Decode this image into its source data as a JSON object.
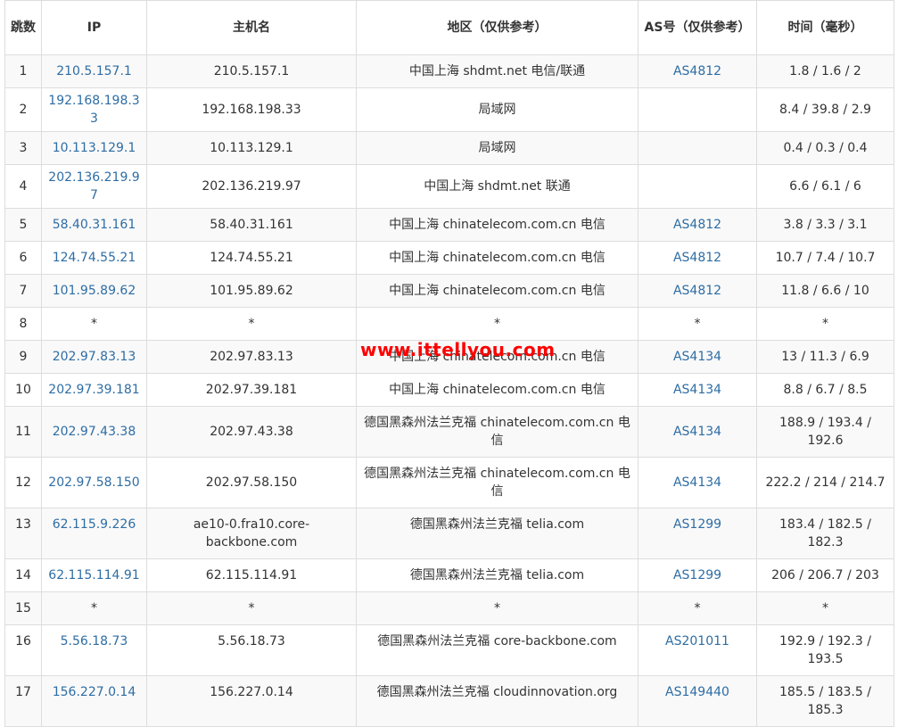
{
  "headers": {
    "hop": "跳数",
    "ip": "IP",
    "host": "主机名",
    "region": "地区（仅供参考）",
    "as": "AS号（仅供参考）",
    "time": "时间（毫秒）"
  },
  "rows": [
    {
      "hop": "1",
      "ip": "210.5.157.1",
      "host": "210.5.157.1",
      "region": "中国上海 shdmt.net 电信/联通",
      "as": "AS4812",
      "time": "1.8 / 1.6 / 2"
    },
    {
      "hop": "2",
      "ip": "192.168.198.33",
      "host": "192.168.198.33",
      "region": "局域网",
      "as": "",
      "time": "8.4 / 39.8 / 2.9"
    },
    {
      "hop": "3",
      "ip": "10.113.129.1",
      "host": "10.113.129.1",
      "region": "局域网",
      "as": "",
      "time": "0.4 / 0.3 / 0.4"
    },
    {
      "hop": "4",
      "ip": "202.136.219.97",
      "host": "202.136.219.97",
      "region": "中国上海 shdmt.net 联通",
      "as": "",
      "time": "6.6 / 6.1 / 6"
    },
    {
      "hop": "5",
      "ip": "58.40.31.161",
      "host": "58.40.31.161",
      "region": "中国上海 chinatelecom.com.cn 电信",
      "as": "AS4812",
      "time": "3.8 / 3.3 / 3.1"
    },
    {
      "hop": "6",
      "ip": "124.74.55.21",
      "host": "124.74.55.21",
      "region": "中国上海 chinatelecom.com.cn 电信",
      "as": "AS4812",
      "time": "10.7 / 7.4 / 10.7"
    },
    {
      "hop": "7",
      "ip": "101.95.89.62",
      "host": "101.95.89.62",
      "region": "中国上海 chinatelecom.com.cn 电信",
      "as": "AS4812",
      "time": "11.8 / 6.6 / 10"
    },
    {
      "hop": "8",
      "ip": "*",
      "host": "*",
      "region": "*",
      "as": "*",
      "time": "*"
    },
    {
      "hop": "9",
      "ip": "202.97.83.13",
      "host": "202.97.83.13",
      "region": "中国上海 chinatelecom.com.cn 电信",
      "as": "AS4134",
      "time": "13 / 11.3 / 6.9"
    },
    {
      "hop": "10",
      "ip": "202.97.39.181",
      "host": "202.97.39.181",
      "region": "中国上海 chinatelecom.com.cn 电信",
      "as": "AS4134",
      "time": "8.8 / 6.7 / 8.5"
    },
    {
      "hop": "11",
      "ip": "202.97.43.38",
      "host": "202.97.43.38",
      "region": "德国黑森州法兰克福 chinatelecom.com.cn 电信",
      "as": "AS4134",
      "time": "188.9 / 193.4 / 192.6"
    },
    {
      "hop": "12",
      "ip": "202.97.58.150",
      "host": "202.97.58.150",
      "region": "德国黑森州法兰克福 chinatelecom.com.cn 电信",
      "as": "AS4134",
      "time": "222.2 / 214 / 214.7"
    },
    {
      "hop": "13",
      "ip": "62.115.9.226",
      "host": "ae10-0.fra10.core-backbone.com",
      "region": "德国黑森州法兰克福 telia.com",
      "as": "AS1299",
      "time": "183.4 / 182.5 / 182.3"
    },
    {
      "hop": "14",
      "ip": "62.115.114.91",
      "host": "62.115.114.91",
      "region": "德国黑森州法兰克福 telia.com",
      "as": "AS1299",
      "time": "206 / 206.7 / 203"
    },
    {
      "hop": "15",
      "ip": "*",
      "host": "*",
      "region": "*",
      "as": "*",
      "time": "*"
    },
    {
      "hop": "16",
      "ip": "5.56.18.73",
      "host": "5.56.18.73",
      "region": "德国黑森州法兰克福 core-backbone.com",
      "as": "AS201011",
      "time": "192.9 / 192.3 / 193.5"
    },
    {
      "hop": "17",
      "ip": "156.227.0.14",
      "host": "156.227.0.14",
      "region": "德国黑森州法兰克福 cloudinnovation.org",
      "as": "AS149440",
      "time": "185.5 / 183.5 / 185.3"
    }
  ],
  "watermark": "www.ittellyou.com",
  "colors": {
    "link": "#2e6da4",
    "watermark": "#ff0000",
    "stripe": "#f9f9f9",
    "border": "#dddddd"
  }
}
